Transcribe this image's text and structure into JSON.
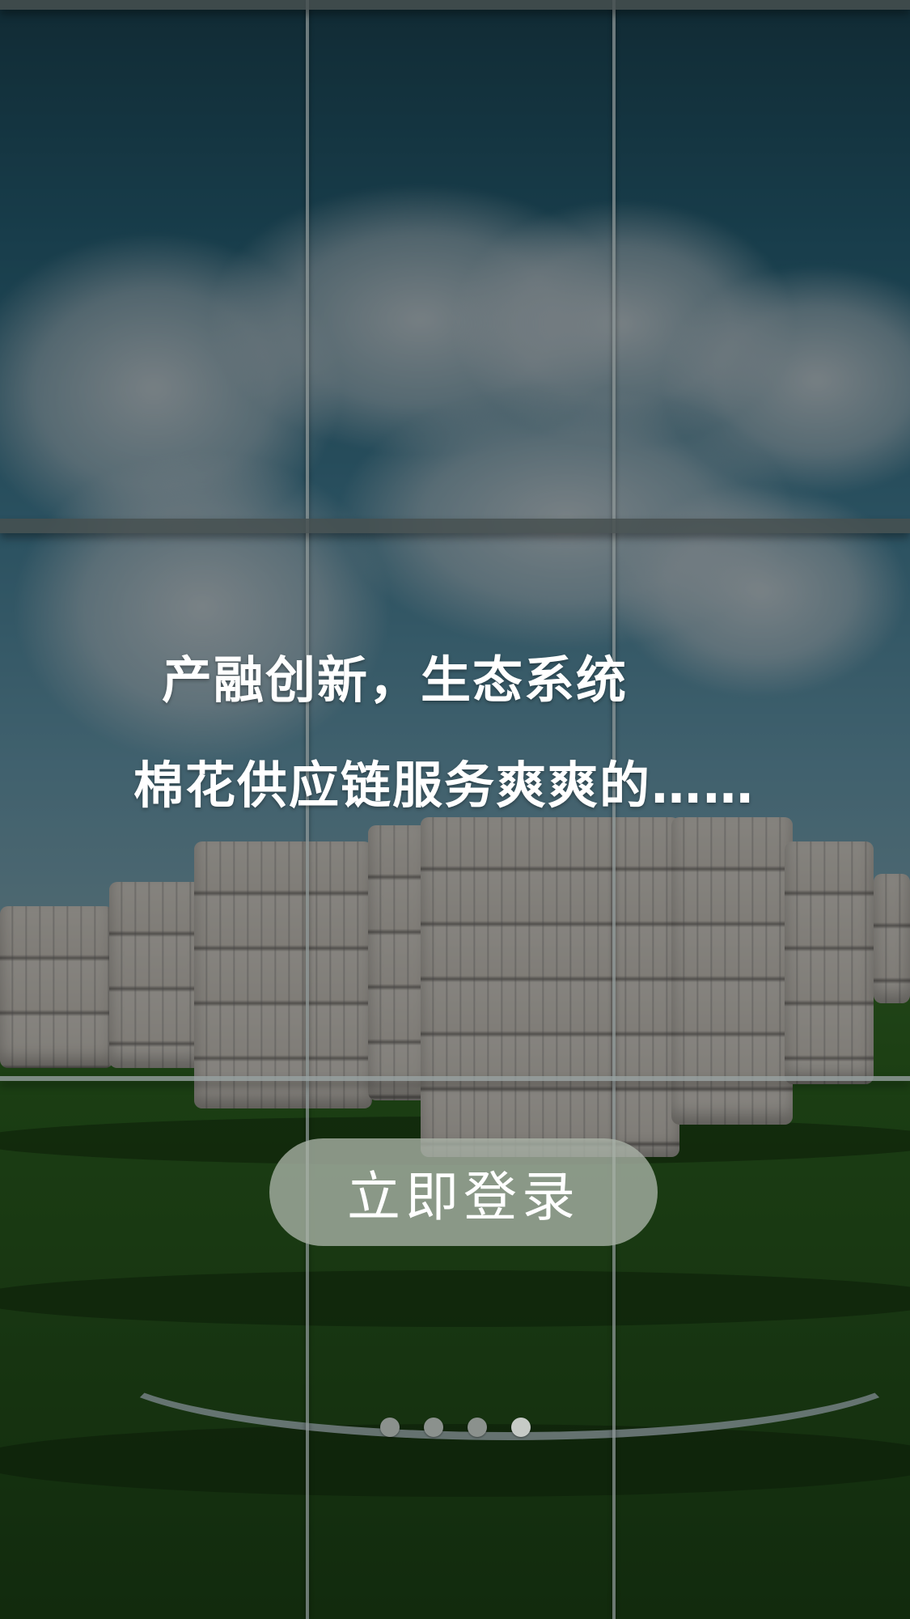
{
  "slogan": {
    "line1": "产融创新，生态系统",
    "line2": "棉花供应链服务爽爽的……"
  },
  "login_button": {
    "label": "立即登录"
  },
  "pager": {
    "count": 4,
    "active_index": 3
  },
  "colors": {
    "button_bg": "#aab4a8",
    "text": "#ffffff",
    "dot_inactive": "#8b918d",
    "dot_active": "#c6cac6"
  }
}
